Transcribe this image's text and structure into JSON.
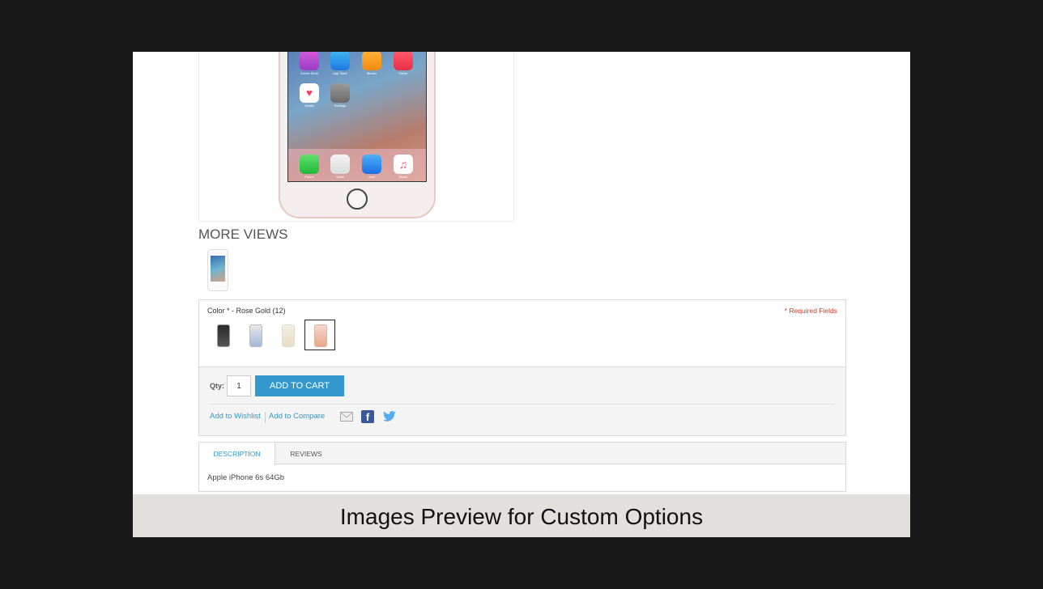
{
  "product": {
    "more_views_title": "MORE VIEWS",
    "apps_row1": [
      "iTunes Store",
      "App Store",
      "iBooks",
      "News"
    ],
    "apps_row2": [
      "Health",
      "Settings"
    ],
    "dock_apps": [
      "Phone",
      "Safari",
      "Mail",
      "Music"
    ]
  },
  "options": {
    "label": "Color * - Rose Gold (12)",
    "required_note": "* Required Fields",
    "swatches": [
      "space-gray",
      "silver",
      "gold",
      "rose-gold"
    ],
    "selected_swatch": "rose-gold"
  },
  "cart": {
    "qty_label": "Qty:",
    "qty_value": "1",
    "add_to_cart": "ADD TO CART",
    "wishlist": "Add to Wishlist",
    "compare": "Add to Compare",
    "share_icons": [
      "email-icon",
      "facebook-icon",
      "twitter-icon"
    ]
  },
  "tabs": {
    "items": [
      "DESCRIPTION",
      "REVIEWS"
    ],
    "active": "DESCRIPTION",
    "description_text": "Apple iPhone 6s 64Gb"
  },
  "caption": "Images Preview for Custom Options",
  "colors": {
    "accent": "#3399cc",
    "required": "#d73820",
    "caption_bg": "#e2e0dd"
  }
}
